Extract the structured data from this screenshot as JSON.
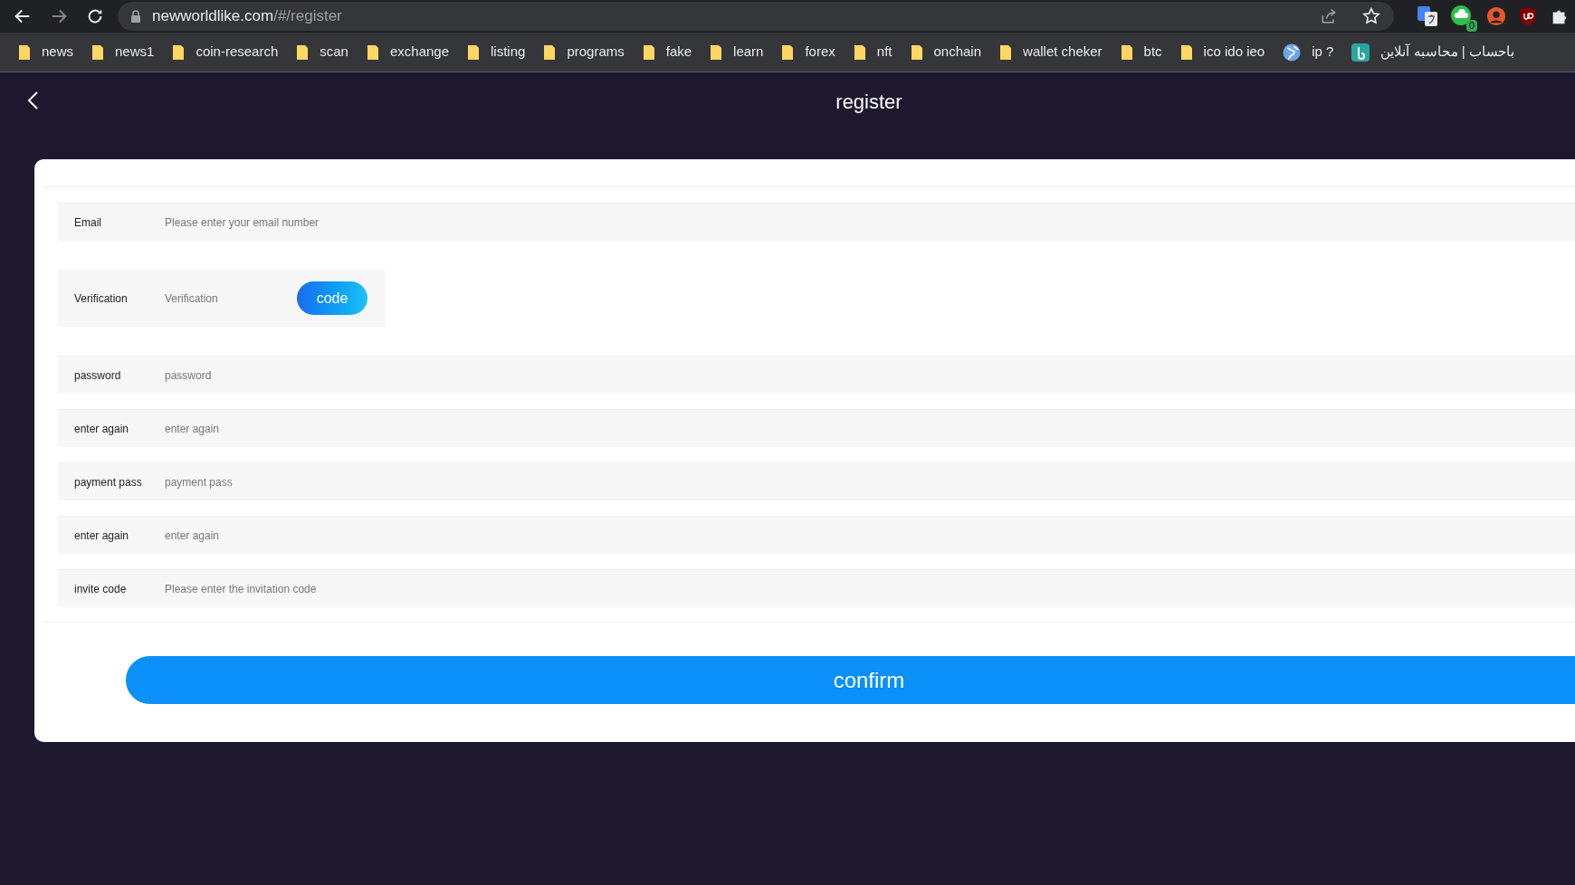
{
  "browser": {
    "url_host": "newworldlike.com",
    "url_path": "/#/register",
    "extension_badge": "0",
    "bookmarks": [
      {
        "kind": "folder",
        "label": "news"
      },
      {
        "kind": "folder",
        "label": "news1"
      },
      {
        "kind": "folder",
        "label": "coin-research"
      },
      {
        "kind": "folder",
        "label": "scan"
      },
      {
        "kind": "folder",
        "label": "exchange"
      },
      {
        "kind": "folder",
        "label": "listing"
      },
      {
        "kind": "folder",
        "label": "programs"
      },
      {
        "kind": "folder",
        "label": "fake"
      },
      {
        "kind": "folder",
        "label": "learn"
      },
      {
        "kind": "folder",
        "label": "forex"
      },
      {
        "kind": "folder",
        "label": "nft"
      },
      {
        "kind": "folder",
        "label": "onchain"
      },
      {
        "kind": "folder",
        "label": "wallet cheker"
      },
      {
        "kind": "folder",
        "label": "btc"
      },
      {
        "kind": "folder",
        "label": "ico ido ieo"
      },
      {
        "kind": "globe",
        "label": "ip ?"
      },
      {
        "kind": "site",
        "label": "باحساب | محاسبه آنلاین"
      }
    ]
  },
  "header": {
    "title": "register"
  },
  "form": {
    "fields": [
      {
        "kind": "text",
        "label": "Email",
        "placeholder": "Please enter your email number"
      },
      {
        "kind": "code",
        "label": "Verification",
        "placeholder": "Verification",
        "button": "code"
      },
      {
        "kind": "text",
        "label": "password",
        "placeholder": "password"
      },
      {
        "kind": "text",
        "label": "enter again",
        "placeholder": "enter again"
      },
      {
        "kind": "text",
        "label": "payment pass",
        "placeholder": "payment pass"
      },
      {
        "kind": "text",
        "label": "enter again",
        "placeholder": "enter again"
      },
      {
        "kind": "text",
        "label": "invite code",
        "placeholder": "Please enter the invitation code"
      }
    ],
    "submit": "confirm"
  }
}
